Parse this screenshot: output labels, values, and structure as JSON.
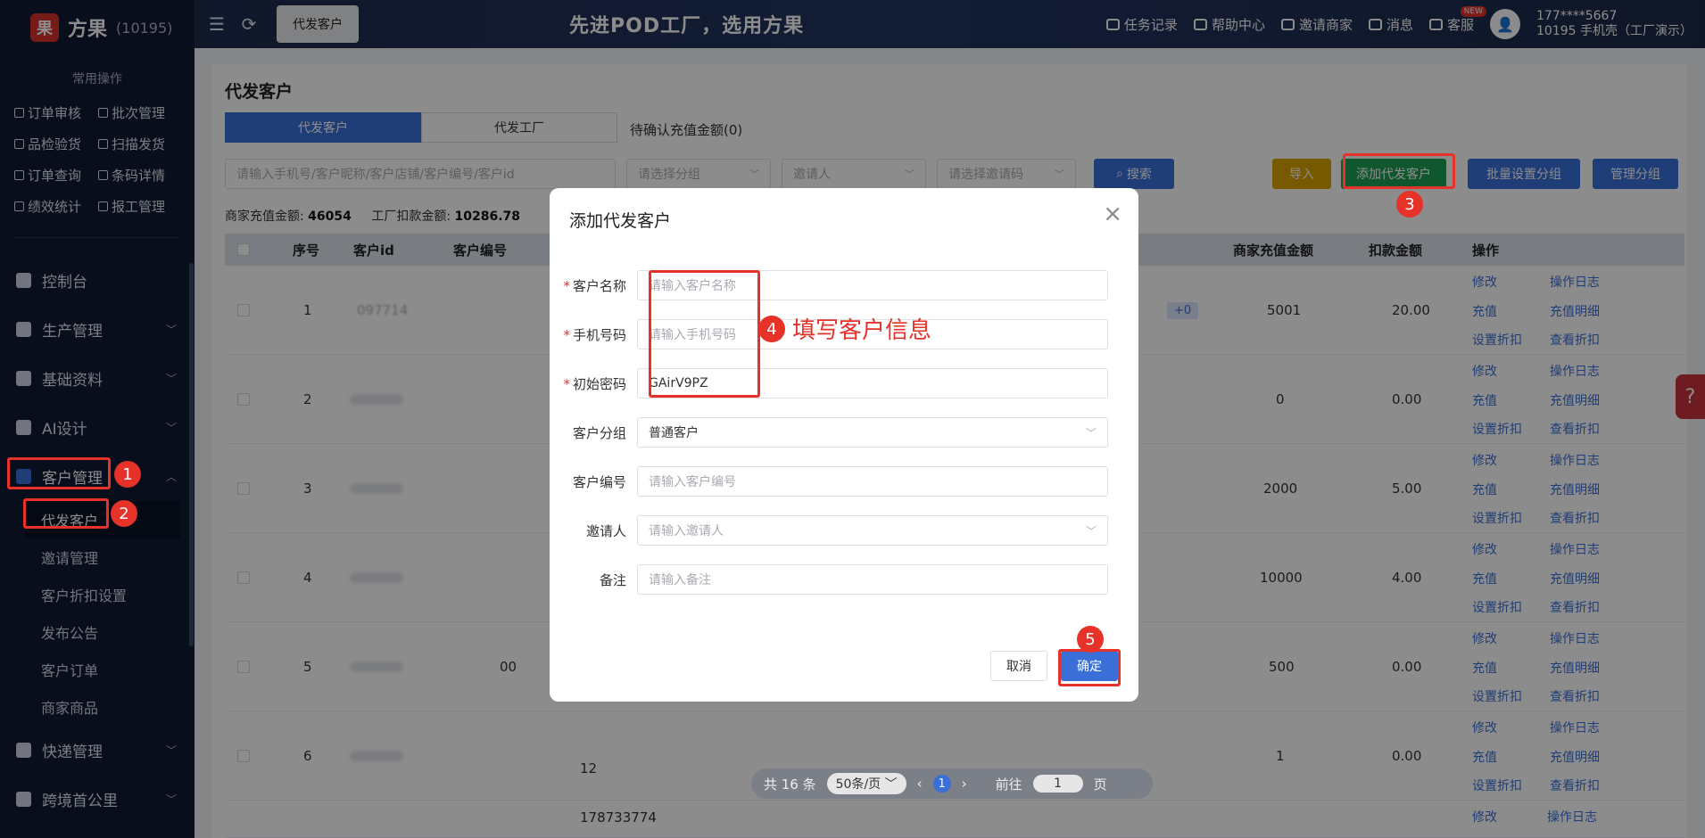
{
  "brand": {
    "name": "方果",
    "id": "(10195)",
    "logo_char": "果"
  },
  "header": {
    "tab_label": "代发客户",
    "slogan": "先进POD工厂，选用方果",
    "links": {
      "tasks": "任务记录",
      "help": "帮助中心",
      "invite": "邀请商家",
      "messages": "消息",
      "service": "客服"
    },
    "new_badge": "NEW",
    "user_phone": "177****5667",
    "user_org": "10195 手机壳（工厂演示）"
  },
  "sidebar": {
    "quick_title": "常用操作",
    "quick": [
      "订单审核",
      "批次管理",
      "品检验货",
      "扫描发货",
      "订单查询",
      "条码详情",
      "绩效统计",
      "报工管理"
    ],
    "nav": {
      "console": "控制台",
      "production": "生产管理",
      "basics": "基础资料",
      "ai": "AI设计",
      "customers": "客户管理",
      "express": "快递管理",
      "cross_border": "跨境首公里"
    },
    "subs": [
      "代发客户",
      "邀请管理",
      "客户折扣设置",
      "发布公告",
      "客户订单",
      "商家商品"
    ]
  },
  "page": {
    "title": "代发客户",
    "segments": [
      "代发客户",
      "代发工厂"
    ],
    "pending": "待确认充值金额(0)",
    "filters": {
      "keyword_ph": "请输入手机号/客户昵称/客户店铺/客户编号/客户id",
      "group_ph": "请选择分组",
      "inviter_ph": "邀请人",
      "code_ph": "请选择邀请码"
    },
    "buttons": {
      "search": "搜索",
      "import": "导入",
      "add": "添加代发客户",
      "batch_group": "批量设置分组",
      "manage_group": "管理分组"
    },
    "summary": {
      "recharge_label": "商家充值金额:",
      "recharge_value": "46054",
      "deduct_label": "工厂扣款金额:",
      "deduct_value": "10286.78"
    },
    "columns": {
      "index": "序号",
      "cid": "客户id",
      "cno": "客户编号",
      "recharge": "商家充值金额",
      "deduct": "扣款金额",
      "ops": "操作"
    },
    "rows": [
      {
        "i": "1",
        "cid": "097714",
        "cno": "",
        "tag": "+0",
        "recharge": "5001",
        "deduct": "20.00"
      },
      {
        "i": "2",
        "cid": "",
        "cno": "",
        "tag": "",
        "recharge": "0",
        "deduct": "0.00"
      },
      {
        "i": "3",
        "cid": "",
        "cno": "",
        "tag": "",
        "recharge": "2000",
        "deduct": "5.00"
      },
      {
        "i": "4",
        "cid": "",
        "cno": "",
        "tag": "",
        "recharge": "10000",
        "deduct": "4.00"
      },
      {
        "i": "5",
        "cid": "",
        "cno": "00",
        "tag": "",
        "recharge": "500",
        "deduct": "0.00"
      },
      {
        "i": "6",
        "cid": "",
        "cno": "12",
        "tag": "",
        "recharge": "1",
        "deduct": "0.00"
      }
    ],
    "row7_cid": "178733774",
    "ops": {
      "edit": "修改",
      "log": "操作日志",
      "recharge": "充值",
      "recharge_detail": "充值明细",
      "set_discount": "设置折扣",
      "view_discount": "查看折扣"
    }
  },
  "pager": {
    "total": "共 16 条",
    "size": "50条/页",
    "current": "1",
    "goto": "前往",
    "page_input": "1",
    "page_unit": "页"
  },
  "modal": {
    "title": "添加代发客户",
    "fields": {
      "name_label": "客户名称",
      "name_ph": "请输入客户名称",
      "phone_label": "手机号码",
      "phone_ph": "请输入手机号码",
      "pwd_label": "初始密码",
      "pwd_value": "GAirV9PZ",
      "group_label": "客户分组",
      "group_value": "普通客户",
      "cno_label": "客户编号",
      "cno_ph": "请输入客户编号",
      "inviter_label": "邀请人",
      "inviter_ph": "请输入邀请人",
      "remark_label": "备注",
      "remark_ph": "请输入备注"
    },
    "cancel": "取消",
    "ok": "确定"
  },
  "annotations": {
    "n1": "1",
    "n2": "2",
    "n3": "3",
    "n4": "4",
    "n5": "5",
    "hint": "填写客户信息"
  },
  "colors": {
    "primary": "#3a6fd8",
    "green": "#1e9e55",
    "gold": "#d9a400",
    "annotation": "#e7322a",
    "sidebar": "#0f1a33"
  }
}
